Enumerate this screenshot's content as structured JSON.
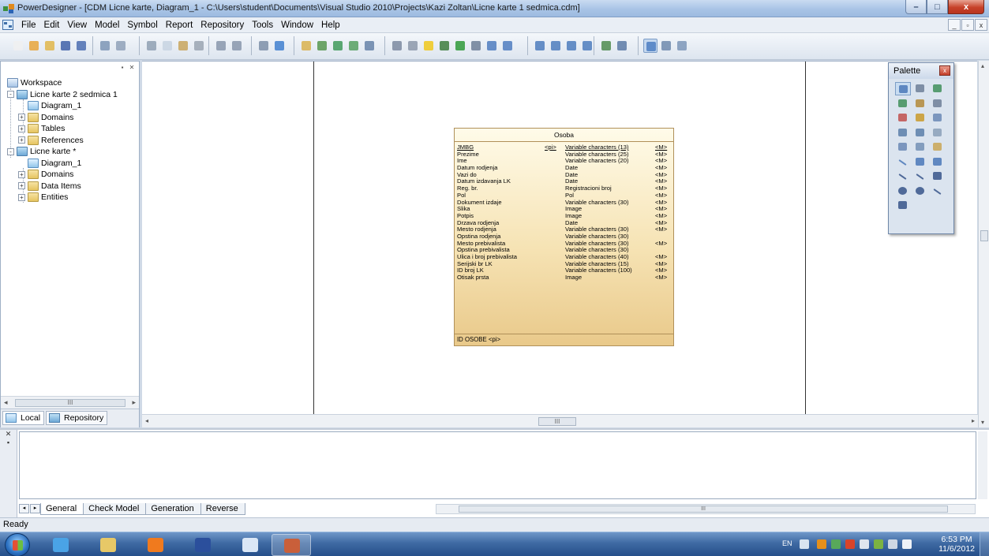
{
  "window": {
    "title": "PowerDesigner - [CDM Licne karte, Diagram_1 - C:\\Users\\student\\Documents\\Visual Studio 2010\\Projects\\Kazi Zoltan\\Licne karte 1 sedmica.cdm]",
    "minimize": "–",
    "maximize": "□",
    "close": "x"
  },
  "menu": [
    "File",
    "Edit",
    "View",
    "Model",
    "Symbol",
    "Report",
    "Repository",
    "Tools",
    "Window",
    "Help"
  ],
  "mdi_buttons": [
    "_",
    "▫",
    "x"
  ],
  "browser": {
    "tree": [
      {
        "label": "Workspace",
        "level": 0,
        "icon": "workspace-icon",
        "expander": ""
      },
      {
        "label": "Licne karte 2 sedmica 1",
        "level": 1,
        "icon": "model-icon",
        "expander": "-"
      },
      {
        "label": "Diagram_1",
        "level": 2,
        "icon": "diagram-icon",
        "expander": ""
      },
      {
        "label": "Domains",
        "level": 2,
        "icon": "folder-icon",
        "expander": "+"
      },
      {
        "label": "Tables",
        "level": 2,
        "icon": "folder-icon",
        "expander": "+"
      },
      {
        "label": "References",
        "level": 2,
        "icon": "folder-icon",
        "expander": "+"
      },
      {
        "label": "Licne karte *",
        "level": 1,
        "icon": "model-icon",
        "expander": "-"
      },
      {
        "label": "Diagram_1",
        "level": 2,
        "icon": "diagram-icon",
        "expander": ""
      },
      {
        "label": "Domains",
        "level": 2,
        "icon": "folder-icon",
        "expander": "+"
      },
      {
        "label": "Data Items",
        "level": 2,
        "icon": "folder-icon",
        "expander": "+"
      },
      {
        "label": "Entities",
        "level": 2,
        "icon": "folder-icon",
        "expander": "+"
      }
    ],
    "tabs": [
      "Local",
      "Repository"
    ],
    "scroll_thumb": "III"
  },
  "entity": {
    "name": "Osoba",
    "attributes": [
      {
        "name": "JMBG",
        "pi": "<pi>",
        "type": "Variable characters (13)",
        "mandatory": "<M>",
        "pk": true
      },
      {
        "name": "Prezime",
        "pi": "",
        "type": "Variable characters (25)",
        "mandatory": "<M>"
      },
      {
        "name": "Ime",
        "pi": "",
        "type": "Variable characters (20)",
        "mandatory": "<M>"
      },
      {
        "name": "Datum rodjenja",
        "pi": "",
        "type": "Date",
        "mandatory": "<M>"
      },
      {
        "name": "Vazi do",
        "pi": "",
        "type": "Date",
        "mandatory": "<M>"
      },
      {
        "name": "Datum izdavanja LK",
        "pi": "",
        "type": "Date",
        "mandatory": "<M>"
      },
      {
        "name": "Reg. br.",
        "pi": "",
        "type": "Registracioni broj",
        "mandatory": "<M>"
      },
      {
        "name": "Pol",
        "pi": "",
        "type": "Pol",
        "mandatory": "<M>"
      },
      {
        "name": "Dokument izdaje",
        "pi": "",
        "type": "Variable characters (30)",
        "mandatory": "<M>"
      },
      {
        "name": "Slika",
        "pi": "",
        "type": "Image",
        "mandatory": "<M>"
      },
      {
        "name": "Potpis",
        "pi": "",
        "type": "Image",
        "mandatory": "<M>"
      },
      {
        "name": "Drzava rodjenja",
        "pi": "",
        "type": "Date",
        "mandatory": "<M>"
      },
      {
        "name": "Mesto rodjenja",
        "pi": "",
        "type": "Variable characters (30)",
        "mandatory": "<M>"
      },
      {
        "name": "Opstina rodjenja",
        "pi": "",
        "type": "Variable characters (30)",
        "mandatory": ""
      },
      {
        "name": "Mesto prebivalista",
        "pi": "",
        "type": "Variable characters (30)",
        "mandatory": "<M>"
      },
      {
        "name": "Opstina prebivalista",
        "pi": "",
        "type": "Variable characters (30)",
        "mandatory": ""
      },
      {
        "name": "Ulica i broj prebivalista",
        "pi": "",
        "type": "Variable characters (40)",
        "mandatory": "<M>"
      },
      {
        "name": "Serijski br LK",
        "pi": "",
        "type": "Variable characters (15)",
        "mandatory": "<M>"
      },
      {
        "name": "ID broj LK",
        "pi": "",
        "type": "Variable characters (100)",
        "mandatory": "<M>"
      },
      {
        "name": "Otisak prsta",
        "pi": "",
        "type": "Image",
        "mandatory": "<M>"
      }
    ],
    "identifier": "ID OSOBE  <pi>"
  },
  "palette": {
    "title": "Palette",
    "tools": [
      "pointer-tool",
      "grabber-tool",
      "zoom-in-tool",
      "zoom-out-tool",
      "open-view-tool",
      "properties-tool",
      "cut-tool",
      "package-tool",
      "entity-tool",
      "relationship-tool",
      "inheritance-tool",
      "association-tool",
      "association-link-tool",
      "file-tool",
      "note-tool",
      "link-tool",
      "rounded-rect-tool",
      "text-tool",
      "line-tool",
      "arc-tool",
      "rectangle-tool",
      "ellipse-tool",
      "round-rectangle-tool",
      "polyline-tool",
      "polygon-tool"
    ]
  },
  "canvas_scroll_thumb": "III",
  "output": {
    "tabs": [
      "General",
      "Check Model",
      "Generation",
      "Reverse"
    ],
    "scroll_thumb": "III"
  },
  "status": "Ready",
  "taskbar": {
    "apps": [
      "internet-explorer",
      "file-explorer",
      "media-player",
      "save-app",
      "word",
      "powerdesigner"
    ],
    "lang": "EN",
    "time": "6:53 PM",
    "date": "11/6/2012"
  }
}
